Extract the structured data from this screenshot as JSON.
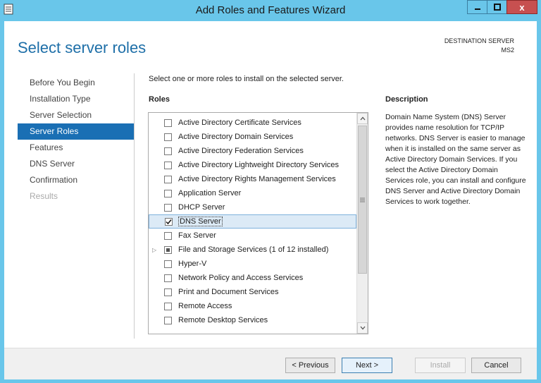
{
  "window": {
    "title": "Add Roles and Features Wizard",
    "close_glyph": "x"
  },
  "header": {
    "page_title": "Select server roles",
    "destination_label": "DESTINATION SERVER",
    "destination_server": "MS2"
  },
  "nav": {
    "items": [
      {
        "label": "Before You Begin",
        "state": "normal"
      },
      {
        "label": "Installation Type",
        "state": "normal"
      },
      {
        "label": "Server Selection",
        "state": "normal"
      },
      {
        "label": "Server Roles",
        "state": "active"
      },
      {
        "label": "Features",
        "state": "normal"
      },
      {
        "label": "DNS Server",
        "state": "normal"
      },
      {
        "label": "Confirmation",
        "state": "normal"
      },
      {
        "label": "Results",
        "state": "disabled"
      }
    ]
  },
  "main": {
    "instruction": "Select one or more roles to install on the selected server.",
    "roles_label": "Roles",
    "roles": [
      {
        "label": "Active Directory Certificate Services",
        "checked": false
      },
      {
        "label": "Active Directory Domain Services",
        "checked": false
      },
      {
        "label": "Active Directory Federation Services",
        "checked": false
      },
      {
        "label": "Active Directory Lightweight Directory Services",
        "checked": false
      },
      {
        "label": "Active Directory Rights Management Services",
        "checked": false
      },
      {
        "label": "Application Server",
        "checked": false
      },
      {
        "label": "DHCP Server",
        "checked": false
      },
      {
        "label": "DNS Server",
        "checked": true,
        "selected": true
      },
      {
        "label": "Fax Server",
        "checked": false
      },
      {
        "label": "File and Storage Services (1 of 12 installed)",
        "checked": "partial",
        "expandable": true
      },
      {
        "label": "Hyper-V",
        "checked": false
      },
      {
        "label": "Network Policy and Access Services",
        "checked": false
      },
      {
        "label": "Print and Document Services",
        "checked": false
      },
      {
        "label": "Remote Access",
        "checked": false
      },
      {
        "label": "Remote Desktop Services",
        "checked": false
      }
    ],
    "description_label": "Description",
    "description": "Domain Name System (DNS) Server provides name resolution for TCP/IP networks. DNS Server is easier to manage when it is installed on the same server as Active Directory Domain Services. If you select the Active Directory Domain Services role, you can install and configure DNS Server and Active Directory Domain Services to work together."
  },
  "footer": {
    "previous": "< Previous",
    "next": "Next >",
    "install": "Install",
    "cancel": "Cancel"
  },
  "colors": {
    "window_frame": "#69c6ea",
    "accent": "#1e6fa8",
    "nav_active": "#1a6fb4",
    "close_button": "#c75050"
  }
}
